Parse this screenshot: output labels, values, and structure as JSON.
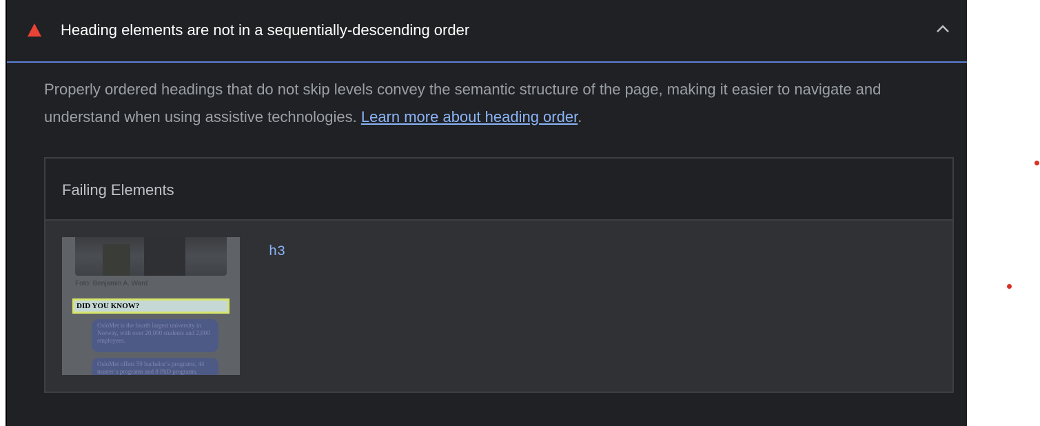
{
  "audit": {
    "title": "Heading elements are not in a sequentially-descending order",
    "description_prefix": "Properly ordered headings that do not skip levels convey the semantic structure of the page, making it easier to navigate and understand when using assistive technologies. ",
    "learn_more_link": "Learn more about heading order",
    "description_suffix": ".",
    "status_icon": "fail-triangle-icon",
    "status_color": "#ea4335",
    "expand_icon": "chevron-up-icon"
  },
  "table": {
    "header": "Failing Elements",
    "rows": [
      {
        "node": "h3",
        "thumbnail": {
          "caption": "Foto: Benjamin A. Ward",
          "highlight_text": "DID YOU KNOW?",
          "bubble_1": "OsloMet is the fourth largest university in Norway, with over 20,000 students and 2,000 employees.",
          "bubble_2": "OsloMet offers 59 bachelor´s programs, 44 master´s programs and 8 PhD programs."
        }
      }
    ]
  },
  "colors": {
    "panel_bg": "#202124",
    "link": "#8ab4f8",
    "accent_border": "#5b7fd6"
  }
}
